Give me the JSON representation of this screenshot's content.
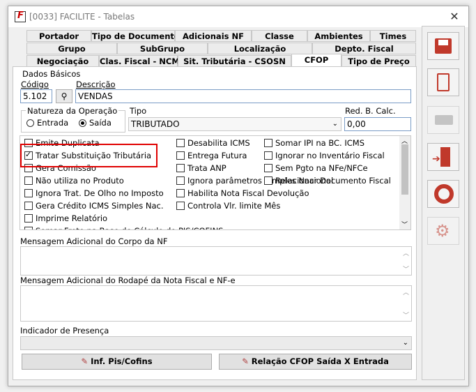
{
  "window": {
    "title": "[0033] FACILITE - Tabelas",
    "close": "✕"
  },
  "tabs": {
    "row1": [
      "Portador",
      "Tipo de Documento",
      "Adicionais NF",
      "Classe",
      "Ambientes",
      "Times"
    ],
    "row2": [
      "Grupo",
      "SubGrupo",
      "Localização",
      "Depto. Fiscal"
    ],
    "row3": [
      "Negociação",
      "Clas. Fiscal - NCM",
      "Sit. Tributária - CSOSN",
      "CFOP",
      "Tipo de Preço"
    ],
    "active": "CFOP"
  },
  "dados": {
    "section_label": "Dados Básicos",
    "codigo_label": "Código",
    "codigo_value": "5.102",
    "descricao_label": "Descrição",
    "descricao_value": "VENDAS",
    "natureza_label": "Natureza da Operação",
    "entrada_label": "Entrada",
    "saida_label": "Saída",
    "tipo_label": "Tipo",
    "tipo_value": "TRIBUTADO",
    "red_label": "Red. B. Calc.",
    "red_value": "0,00"
  },
  "checkboxes": {
    "col1": [
      {
        "label": "Emite Duplicata",
        "checked": false
      },
      {
        "label": "Tratar Substituição Tributária",
        "checked": true
      },
      {
        "label": "Gera Comissão",
        "checked": false
      },
      {
        "label": "Não utiliza no Produto",
        "checked": false
      },
      {
        "label": "Ignora Trat. De Olho no Imposto",
        "checked": false
      },
      {
        "label": "Gera Crédito ICMS Simples Nac.",
        "checked": false
      },
      {
        "label": "Imprime Relatório",
        "checked": false
      },
      {
        "label": "Somar Frete na Base de Cálculo do PIS/COFINS",
        "checked": false
      }
    ],
    "col2": [
      {
        "label": "Desabilita ICMS",
        "checked": false
      },
      {
        "label": "Entrega Futura",
        "checked": false
      },
      {
        "label": "Trata ANP",
        "checked": false
      },
      {
        "label": "Ignora parâmetros Simples Nacional",
        "checked": false
      },
      {
        "label": "Habilita Nota Fiscal Devolução",
        "checked": false
      },
      {
        "label": "Controla Vlr. limite Mês",
        "checked": false
      }
    ],
    "col3": [
      {
        "label": "Somar IPI na BC. ICMS",
        "checked": false
      },
      {
        "label": "Ignorar no Inventário Fiscal",
        "checked": false
      },
      {
        "label": "Sem Pgto na NFe/NFCe",
        "checked": false
      },
      {
        "label": "Relacionar Documento Fiscal",
        "checked": false
      }
    ]
  },
  "mensagem_corpo_label": "Mensagem Adicional do Corpo da NF",
  "mensagem_rodape_label": "Mensagem Adicional do Rodapé da Nota Fiscal e NF-e",
  "indicador_label": "Indicador de Presença",
  "indicador_value": "",
  "buttons": {
    "pis_cofins": "Inf. Pis/Cofins",
    "relacao": "Relação CFOP Saída X Entrada"
  },
  "sidebar_icons": [
    "save-icon",
    "delete-icon",
    "print-icon",
    "exit-icon",
    "help-icon",
    "settings-icon"
  ],
  "colors": {
    "highlight": "#e00000",
    "field_border": "#7a9cc6",
    "icon_red": "#c0392b"
  }
}
